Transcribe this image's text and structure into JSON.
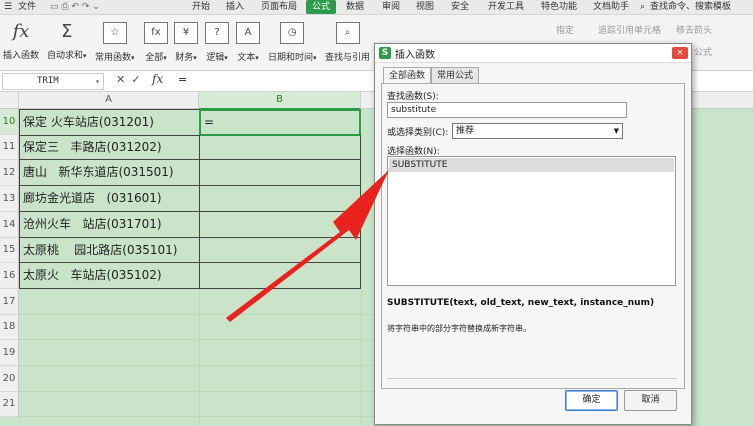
{
  "menubar": {
    "items": [
      "文件",
      "开始",
      "插入",
      "页面布局",
      "公式",
      "数据",
      "审阅",
      "视图",
      "安全",
      "开发工具",
      "特色功能",
      "文档助手"
    ],
    "active_index": 4,
    "search": "查找命令、搜索模板"
  },
  "ribbon": {
    "buttons": [
      "插入函数",
      "自动求和",
      "常用函数",
      "全部",
      "财务",
      "逻辑",
      "文本",
      "日期和时间",
      "查找与引用"
    ],
    "right_labels": [
      "指定",
      "追踪引用单元格",
      "移去箭头",
      "公式"
    ]
  },
  "formula_bar": {
    "name_box": "TRIM",
    "fx": "fx",
    "value": "="
  },
  "columns": [
    "A",
    "B"
  ],
  "rows": [
    {
      "num": "10",
      "a": "保定 火车站店(031201)",
      "b": "="
    },
    {
      "num": "11",
      "a": "保定三   丰路店(031202)",
      "b": ""
    },
    {
      "num": "12",
      "a": "唐山   新华东道店(031501)",
      "b": ""
    },
    {
      "num": "13",
      "a": "廊坊金光道店   (031601)",
      "b": ""
    },
    {
      "num": "14",
      "a": "沧州火车   站店(031701)",
      "b": ""
    },
    {
      "num": "15",
      "a": "太原桃    园北路店(035101)",
      "b": ""
    },
    {
      "num": "16",
      "a": "太原火   车站店(035102)",
      "b": ""
    },
    {
      "num": "17",
      "a": "",
      "b": ""
    },
    {
      "num": "18",
      "a": "",
      "b": ""
    },
    {
      "num": "19",
      "a": "",
      "b": ""
    },
    {
      "num": "20",
      "a": "",
      "b": ""
    },
    {
      "num": "21",
      "a": "",
      "b": ""
    }
  ],
  "dialog": {
    "title": "插入函数",
    "close": "×",
    "tabs": [
      "全部函数",
      "常用公式"
    ],
    "search_label": "查找函数(S):",
    "search_value": "substitute",
    "category_label": "或选择类别(C):",
    "category_value": "推荐",
    "list_label": "选择函数(N):",
    "functions": [
      "SUBSTITUTE"
    ],
    "signature": "SUBSTITUTE(text, old_text, new_text, instance_num)",
    "description": "将字符串中的部分字符替换成新字符串。",
    "ok": "确定",
    "cancel": "取消"
  },
  "colors": {
    "accent": "#2e9b4a",
    "sheet_bg": "#c9e4c9",
    "arrow": "#e8231e"
  }
}
